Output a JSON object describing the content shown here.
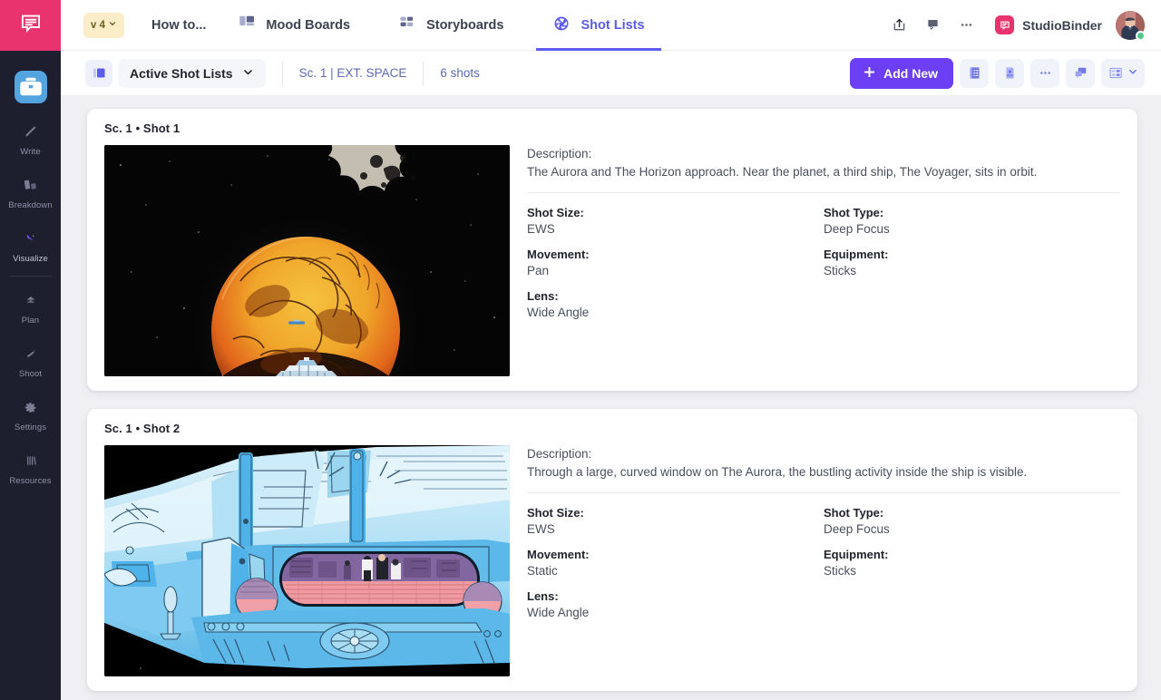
{
  "left_rail": {
    "logo_icon": "speech-bubble-logo",
    "items": [
      {
        "label": "",
        "icon": "briefcase-icon",
        "active": true
      },
      {
        "label": "Write",
        "icon": "pen-icon",
        "active": false
      },
      {
        "label": "Breakdown",
        "icon": "blocks-icon",
        "active": false
      },
      {
        "label": "Visualize",
        "icon": "shapes-icon",
        "active": true
      },
      {
        "label": "Plan",
        "icon": "triangle-icon",
        "active": false
      },
      {
        "label": "Shoot",
        "icon": "clapper-icon",
        "active": false
      },
      {
        "label": "Settings",
        "icon": "gear-icon",
        "active": false
      },
      {
        "label": "Resources",
        "icon": "books-icon",
        "active": false
      }
    ]
  },
  "top_nav": {
    "version_label": "v 4",
    "version_caret": "chevron-down-icon",
    "project_title": "How to...",
    "tabs": [
      {
        "label": "Mood Boards",
        "icon": "mood-boards-icon",
        "active": false
      },
      {
        "label": "Storyboards",
        "icon": "storyboards-icon",
        "active": false
      },
      {
        "label": "Shot Lists",
        "icon": "aperture-icon",
        "active": true
      }
    ],
    "actions": [
      {
        "name": "share-icon"
      },
      {
        "name": "comment-check-icon"
      },
      {
        "name": "more-options-icon"
      }
    ],
    "brand_name": "StudioBinder",
    "brand_icon": "studiobinder-logo",
    "avatar": "user-avatar",
    "avatar_status": "online"
  },
  "toolbar": {
    "list_icon": "panel-layout-icon",
    "active_list_label": "Active Shot Lists",
    "active_list_caret": "chevron-down-icon",
    "scene_label": "Sc. 1 | EXT. SPACE",
    "shot_count": "6 shots",
    "add_new_label": "Add New",
    "add_new_icon": "plus-icon",
    "actions": [
      {
        "name": "notebook-icon"
      },
      {
        "name": "pdf-export-icon"
      },
      {
        "name": "more-options-icon"
      },
      {
        "name": "comment-icon"
      },
      {
        "name": "view-layout-icon"
      }
    ]
  },
  "labels": {
    "description": "Description:",
    "shot_size": "Shot Size:",
    "shot_type": "Shot Type:",
    "movement": "Movement:",
    "equipment": "Equipment:",
    "lens": "Lens:"
  },
  "shots": [
    {
      "heading": "Sc. 1 • Shot  1",
      "thumbnail": "planet-orbit-storyboard",
      "description": "The Aurora and The Horizon approach. Near the planet, a third ship, The Voyager, sits in orbit.",
      "shot_size": "EWS",
      "shot_type": "Deep Focus",
      "movement": "Pan",
      "equipment": "Sticks",
      "lens": "Wide Angle"
    },
    {
      "heading": "Sc. 1 • Shot  2",
      "thumbnail": "ship-window-storyboard",
      "description": "Through a large, curved window on The Aurora, the bustling activity inside the ship is visible.",
      "shot_size": "EWS",
      "shot_type": "Deep Focus",
      "movement": "Static",
      "equipment": "Sticks",
      "lens": "Wide Angle"
    }
  ],
  "colors": {
    "brand_pink": "#e8336e",
    "accent_purple": "#6c3ef4",
    "tab_active": "#5b5bf0",
    "rail_bg": "#1e1f2e",
    "chip_yellow": "#faedc8"
  }
}
